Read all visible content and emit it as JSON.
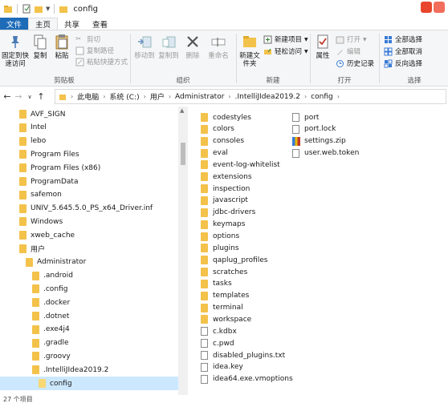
{
  "window": {
    "title": "config"
  },
  "tabs": [
    "文件",
    "主页",
    "共享",
    "查看"
  ],
  "ribbon": {
    "clipboard": {
      "label": "剪贴板",
      "pin": "固定到快速访问",
      "copy": "复制",
      "paste": "粘贴",
      "cut": "剪切",
      "copy_path": "复制路径",
      "paste_shortcut": "粘贴快捷方式"
    },
    "organize": {
      "label": "组织",
      "move_to": "移动到",
      "copy_to": "复制到",
      "delete": "删除",
      "rename": "重命名"
    },
    "new": {
      "label": "新建",
      "new_folder": "新建文件夹",
      "new_item": "新建项目",
      "easy_access": "轻松访问"
    },
    "open": {
      "label": "打开",
      "properties": "属性",
      "open": "打开",
      "edit": "编辑",
      "history": "历史记录"
    },
    "select": {
      "label": "选择",
      "select_all": "全部选择",
      "select_none": "全部取消",
      "invert": "反向选择"
    }
  },
  "address": {
    "crumbs": [
      "此电脑",
      "系统 (C:)",
      "用户",
      "Administrator",
      ".IntelliJIdea2019.2",
      "config"
    ]
  },
  "nav_items": [
    {
      "label": "AVF_SIGN",
      "level": 1
    },
    {
      "label": "Intel",
      "level": 1
    },
    {
      "label": "lebo",
      "level": 1
    },
    {
      "label": "Program Files",
      "level": 1
    },
    {
      "label": "Program Files (x86)",
      "level": 1
    },
    {
      "label": "ProgramData",
      "level": 1
    },
    {
      "label": "safemon",
      "level": 1
    },
    {
      "label": "UNIV_5.645.5.0_PS_x64_Driver.inf",
      "level": 1
    },
    {
      "label": "Windows",
      "level": 1
    },
    {
      "label": "xweb_cache",
      "level": 1
    },
    {
      "label": "用户",
      "level": 1
    },
    {
      "label": "Administrator",
      "level": 2
    },
    {
      "label": ".android",
      "level": 3
    },
    {
      "label": ".config",
      "level": 3
    },
    {
      "label": ".docker",
      "level": 3
    },
    {
      "label": ".dotnet",
      "level": 3
    },
    {
      "label": ".exe4j4",
      "level": 3
    },
    {
      "label": ".gradle",
      "level": 3
    },
    {
      "label": ".groovy",
      "level": 3
    },
    {
      "label": ".IntelliJIdea2019.2",
      "level": 3
    },
    {
      "label": "config",
      "level": 4,
      "selected": true
    }
  ],
  "files_col1": [
    {
      "name": "codestyles",
      "type": "folder"
    },
    {
      "name": "colors",
      "type": "folder"
    },
    {
      "name": "consoles",
      "type": "folder"
    },
    {
      "name": "eval",
      "type": "folder"
    },
    {
      "name": "event-log-whitelist",
      "type": "folder"
    },
    {
      "name": "extensions",
      "type": "folder"
    },
    {
      "name": "inspection",
      "type": "folder"
    },
    {
      "name": "javascript",
      "type": "folder"
    },
    {
      "name": "jdbc-drivers",
      "type": "folder"
    },
    {
      "name": "keymaps",
      "type": "folder"
    },
    {
      "name": "options",
      "type": "folder"
    },
    {
      "name": "plugins",
      "type": "folder"
    },
    {
      "name": "qaplug_profiles",
      "type": "folder"
    },
    {
      "name": "scratches",
      "type": "folder"
    },
    {
      "name": "tasks",
      "type": "folder"
    },
    {
      "name": "templates",
      "type": "folder"
    },
    {
      "name": "terminal",
      "type": "folder"
    },
    {
      "name": "workspace",
      "type": "folder"
    },
    {
      "name": "c.kdbx",
      "type": "file"
    },
    {
      "name": "c.pwd",
      "type": "file"
    },
    {
      "name": "disabled_plugins.txt",
      "type": "file"
    },
    {
      "name": "idea.key",
      "type": "file"
    },
    {
      "name": "idea64.exe.vmoptions",
      "type": "file"
    }
  ],
  "files_col2": [
    {
      "name": "port",
      "type": "file"
    },
    {
      "name": "port.lock",
      "type": "file"
    },
    {
      "name": "settings.zip",
      "type": "zip"
    },
    {
      "name": "user.web.token",
      "type": "file"
    }
  ],
  "status": {
    "count": "27 个项目"
  },
  "colors": {
    "file_tab": "#1e6bb8",
    "folder": "#f3c24b",
    "selection": "#cce8ff"
  }
}
